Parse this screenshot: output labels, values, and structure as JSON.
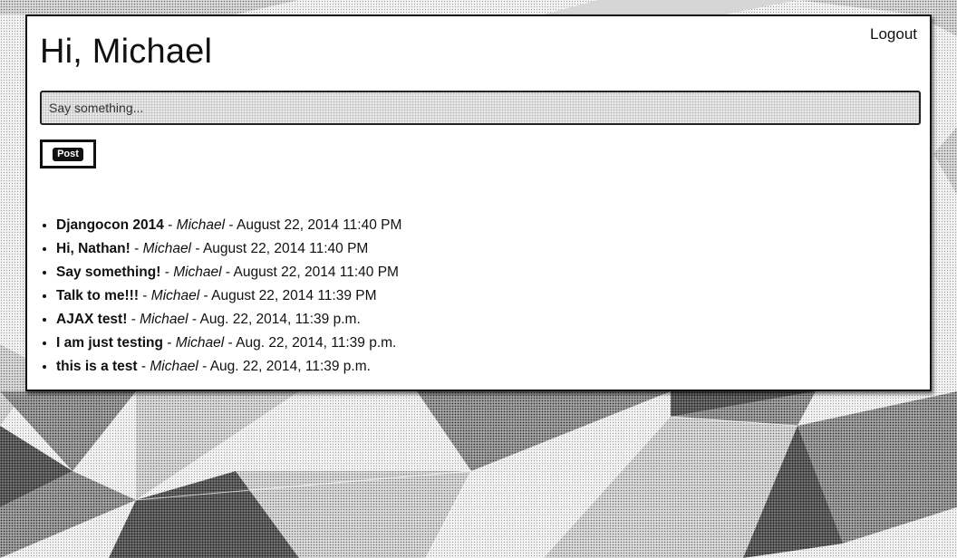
{
  "page": {
    "greeting": "Hi, Michael",
    "logout_label": "Logout"
  },
  "composer": {
    "placeholder": "Say something...",
    "post_label": "Post"
  },
  "posts": [
    {
      "title": "Djangocon 2014",
      "author": "Michael",
      "timestamp": "August 22, 2014 11:40 PM"
    },
    {
      "title": "Hi, Nathan!",
      "author": "Michael",
      "timestamp": "August 22, 2014 11:40 PM"
    },
    {
      "title": "Say something!",
      "author": "Michael",
      "timestamp": "August 22, 2014 11:40 PM"
    },
    {
      "title": "Talk to me!!!",
      "author": "Michael",
      "timestamp": "August 22, 2014 11:39 PM"
    },
    {
      "title": "AJAX test!",
      "author": "Michael",
      "timestamp": "Aug. 22, 2014, 11:39 p.m."
    },
    {
      "title": "I am just testing",
      "author": "Michael",
      "timestamp": "Aug. 22, 2014, 11:39 p.m."
    },
    {
      "title": "this is a test",
      "author": "Michael",
      "timestamp": "Aug. 22, 2014, 11:39 p.m."
    }
  ],
  "separator": " - ",
  "colors": {
    "card_background": "#ffffff",
    "text": "#111111",
    "input_background": "#e9e9e9"
  }
}
